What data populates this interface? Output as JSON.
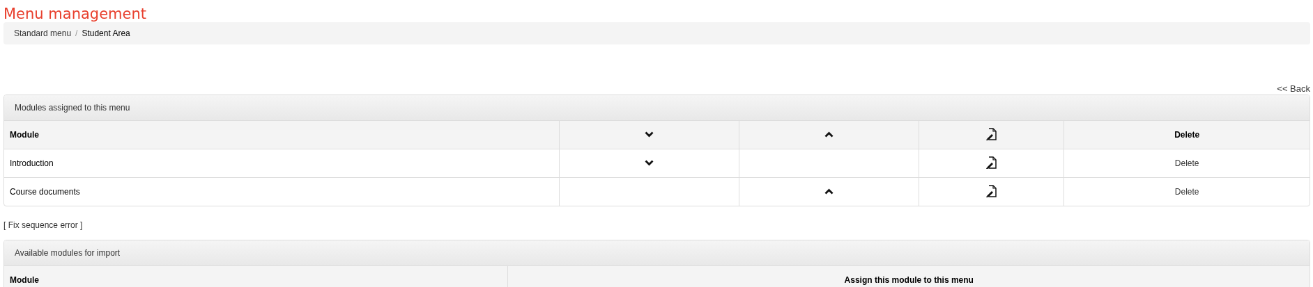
{
  "page_title": "Menu management",
  "breadcrumb": [
    {
      "label": "Standard menu",
      "current": false
    },
    {
      "label": "Student Area",
      "current": true
    }
  ],
  "breadcrumb_separator": "/",
  "back_link": "<< Back",
  "assigned_panel": {
    "heading": "Modules assigned to this menu",
    "columns": [
      {
        "kind": "text",
        "label": "Module"
      },
      {
        "kind": "down"
      },
      {
        "kind": "up"
      },
      {
        "kind": "edit"
      },
      {
        "kind": "text",
        "label": "Delete"
      }
    ],
    "rows": [
      {
        "module": "Introduction",
        "move_down": true,
        "move_up": false,
        "delete": "Delete"
      },
      {
        "module": "Course documents",
        "move_down": false,
        "move_up": true,
        "delete": "Delete"
      }
    ]
  },
  "fix_link": "[ Fix sequence error ]",
  "available_panel": {
    "heading": "Available modules for import",
    "columns": [
      "Module",
      "Assign this module to this menu"
    ]
  }
}
